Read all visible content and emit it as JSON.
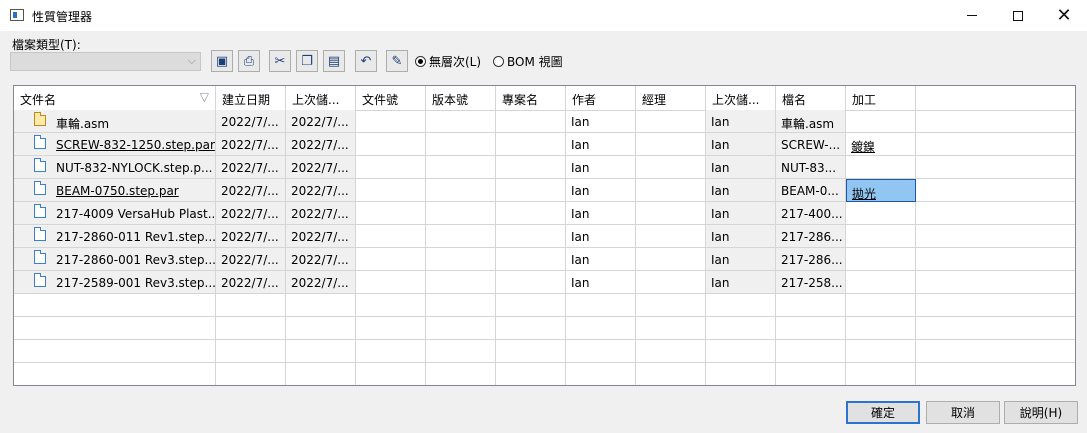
{
  "window": {
    "title": "性質管理器"
  },
  "toolbar": {
    "file_type_label": "檔案類型(T):",
    "file_type_value": "",
    "buttons": [
      {
        "name": "save-icon",
        "glyph": "🖫"
      },
      {
        "name": "print-icon",
        "glyph": "⎙"
      },
      {
        "name": "cut-icon",
        "glyph": "✂"
      },
      {
        "name": "copy-icon",
        "glyph": "❐"
      },
      {
        "name": "paste-icon",
        "glyph": "📋"
      },
      {
        "name": "undo-icon",
        "glyph": "↶"
      },
      {
        "name": "edit-icon",
        "glyph": "✎"
      }
    ],
    "radio_flat": "無層次(L)",
    "radio_bom": "BOM 視圖",
    "radio_selected": "flat"
  },
  "grid": {
    "columns": [
      "文件名",
      "建立日期",
      "上次儲...",
      "文件號",
      "版本號",
      "專案名",
      "作者",
      "經理",
      "上次儲...",
      "檔名",
      "加工",
      ""
    ],
    "rows": [
      {
        "icon": "assembly",
        "name": "車輪.asm",
        "linked": false,
        "created": "2022/7/...",
        "last_saved": "2022/7/...",
        "doc_no": "",
        "rev": "",
        "project": "",
        "author": "Ian",
        "manager": "",
        "last_saved_by": "Ian",
        "filename": "車輪.asm",
        "process": "",
        "process_link": false
      },
      {
        "icon": "part",
        "name": "SCREW-832-1250.step.par",
        "linked": true,
        "created": "2022/7/...",
        "last_saved": "2022/7/...",
        "doc_no": "",
        "rev": "",
        "project": "",
        "author": "Ian",
        "manager": "",
        "last_saved_by": "Ian",
        "filename": "SCREW-...",
        "process": "鍍鎳",
        "process_link": true
      },
      {
        "icon": "part",
        "name": "NUT-832-NYLOCK.step.p...",
        "linked": false,
        "created": "2022/7/...",
        "last_saved": "2022/7/...",
        "doc_no": "",
        "rev": "",
        "project": "",
        "author": "Ian",
        "manager": "",
        "last_saved_by": "Ian",
        "filename": "NUT-83...",
        "process": "",
        "process_link": false
      },
      {
        "icon": "part",
        "name": "BEAM-0750.step.par",
        "linked": true,
        "created": "2022/7/...",
        "last_saved": "2022/7/...",
        "doc_no": "",
        "rev": "",
        "project": "",
        "author": "Ian",
        "manager": "",
        "last_saved_by": "Ian",
        "filename": "BEAM-0...",
        "process": "拋光",
        "process_link": true
      },
      {
        "icon": "part",
        "name": "217-4009 VersaHub Plast...",
        "linked": false,
        "created": "2022/7/...",
        "last_saved": "2022/7/...",
        "doc_no": "",
        "rev": "",
        "project": "",
        "author": "Ian",
        "manager": "",
        "last_saved_by": "Ian",
        "filename": "217-400...",
        "process": "",
        "process_link": false
      },
      {
        "icon": "part",
        "name": "217-2860-011 Rev1.step....",
        "linked": false,
        "created": "2022/7/...",
        "last_saved": "2022/7/...",
        "doc_no": "",
        "rev": "",
        "project": "",
        "author": "Ian",
        "manager": "",
        "last_saved_by": "Ian",
        "filename": "217-286...",
        "process": "",
        "process_link": false
      },
      {
        "icon": "part",
        "name": "217-2860-001 Rev3.step....",
        "linked": false,
        "created": "2022/7/...",
        "last_saved": "2022/7/...",
        "doc_no": "",
        "rev": "",
        "project": "",
        "author": "Ian",
        "manager": "",
        "last_saved_by": "Ian",
        "filename": "217-286...",
        "process": "",
        "process_link": false
      },
      {
        "icon": "part",
        "name": "217-2589-001 Rev3.step...",
        "linked": false,
        "created": "2022/7/...",
        "last_saved": "2022/7/...",
        "doc_no": "",
        "rev": "",
        "project": "",
        "author": "Ian",
        "manager": "",
        "last_saved_by": "Ian",
        "filename": "217-258...",
        "process": "",
        "process_link": false
      }
    ],
    "empty_rows": 4,
    "selected_row": 3,
    "selected_column": "process"
  },
  "footer": {
    "ok": "確定",
    "cancel": "取消",
    "help": "說明(H)"
  },
  "colors": {
    "selection": "#91c6f2",
    "default_button_border": "#2b73cf",
    "readonly_cell": "#f0f0f0"
  }
}
